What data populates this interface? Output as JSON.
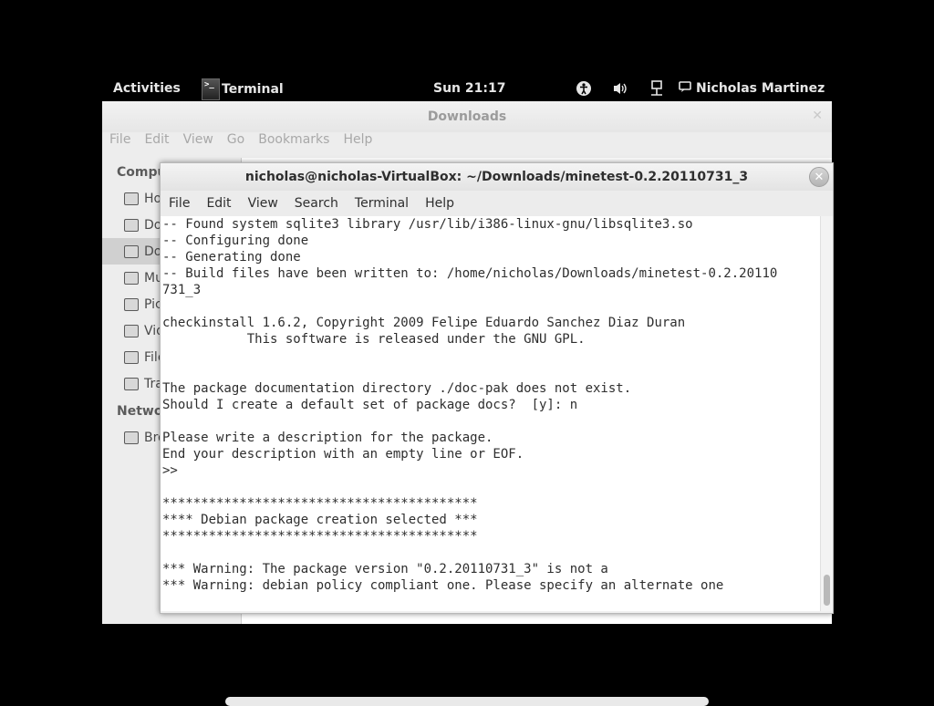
{
  "topbar": {
    "activities": "Activities",
    "app_name": "Terminal",
    "app_icon_glyph": ">_",
    "clock": "Sun 21:17",
    "user": "Nicholas Martinez",
    "tray_icons": [
      "accessibility-icon",
      "volume-icon",
      "network-icon",
      "chat-icon"
    ]
  },
  "files": {
    "title": "Downloads",
    "menu": [
      "File",
      "Edit",
      "View",
      "Go",
      "Bookmarks",
      "Help"
    ],
    "sidebar": {
      "computer_head": "Compu",
      "items": [
        "Ho",
        "Do",
        "Do",
        "Mu",
        "Pic",
        "Vid",
        "File",
        "Tra"
      ],
      "network_head": "Netwo",
      "network_items": [
        "Bro"
      ]
    }
  },
  "terminal": {
    "title": "nicholas@nicholas-VirtualBox: ~/Downloads/minetest-0.2.20110731_3",
    "menu": [
      "File",
      "Edit",
      "View",
      "Search",
      "Terminal",
      "Help"
    ],
    "output": "-- Found system sqlite3 library /usr/lib/i386-linux-gnu/libsqlite3.so\n-- Configuring done\n-- Generating done\n-- Build files have been written to: /home/nicholas/Downloads/minetest-0.2.20110\n731_3\n\ncheckinstall 1.6.2, Copyright 2009 Felipe Eduardo Sanchez Diaz Duran\n           This software is released under the GNU GPL.\n\n\nThe package documentation directory ./doc-pak does not exist.\nShould I create a default set of package docs?  [y]: n\n\nPlease write a description for the package.\nEnd your description with an empty line or EOF.\n>>\n\n*****************************************\n**** Debian package creation selected ***\n*****************************************\n\n*** Warning: The package version \"0.2.20110731_3\" is not a\n*** Warning: debian policy compliant one. Please specify an alternate one"
  },
  "colors": {
    "desktop_bg": "#000000",
    "topbar_text": "#e6e6e6",
    "terminal_text": "#2e2e2e",
    "terminal_bg": "#ffffff"
  }
}
